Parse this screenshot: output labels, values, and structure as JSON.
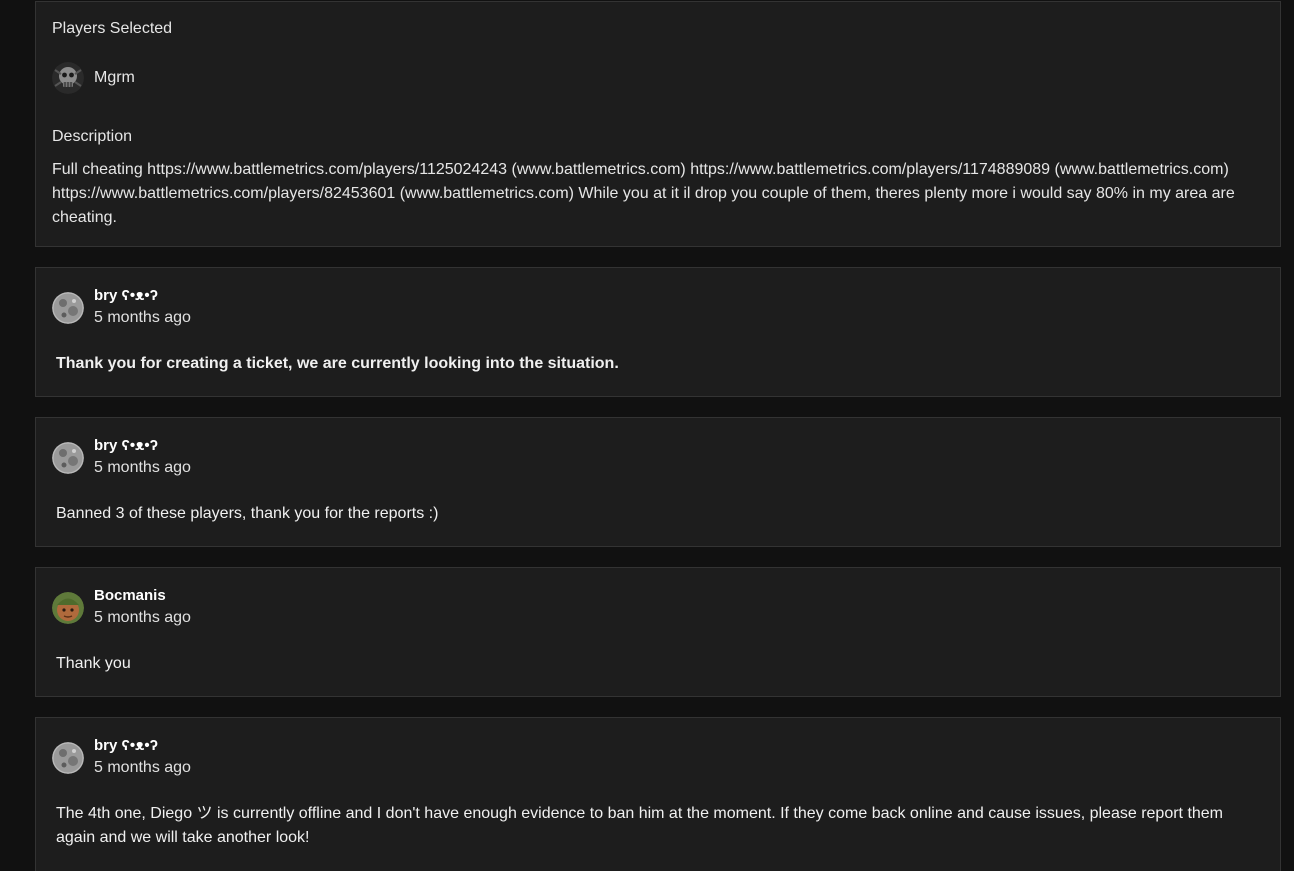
{
  "ticket": {
    "players_label": "Players Selected",
    "player_name": "Mgrm",
    "description_label": "Description",
    "description_text": "Full cheating https://www.battlemetrics.com/players/1125024243 (www.battlemetrics.com) https://www.battlemetrics.com/players/1174889089 (www.battlemetrics.com) https://www.battlemetrics.com/players/82453601 (www.battlemetrics.com) While you at it il drop you couple of them, theres plenty more i would say 80% in my area are cheating."
  },
  "comments": [
    {
      "author": "bry ʕ•ᴥ•ʔ",
      "time": "5 months ago",
      "body": "Thank you for creating a ticket, we are currently looking into the situation.",
      "avatar_icon": "moon-avatar-icon"
    },
    {
      "author": "bry ʕ•ᴥ•ʔ",
      "time": "5 months ago",
      "body": "Banned 3 of these players, thank you for the reports :)",
      "avatar_icon": "moon-avatar-icon"
    },
    {
      "author": "Bocmanis",
      "time": "5 months ago",
      "body": "Thank you",
      "avatar_icon": "face-avatar-icon"
    },
    {
      "author": "bry ʕ•ᴥ•ʔ",
      "time": "5 months ago",
      "body": "The 4th one, Diego ツ is currently offline and I don't have enough evidence to ban him at the moment. If they come back online and cause issues, please report them again and we will take another look!",
      "avatar_icon": "moon-avatar-icon"
    }
  ],
  "colors": {
    "page_bg": "#111111",
    "card_bg": "#1d1d1d",
    "card_border": "#333333",
    "text": "#e6e6e6"
  }
}
